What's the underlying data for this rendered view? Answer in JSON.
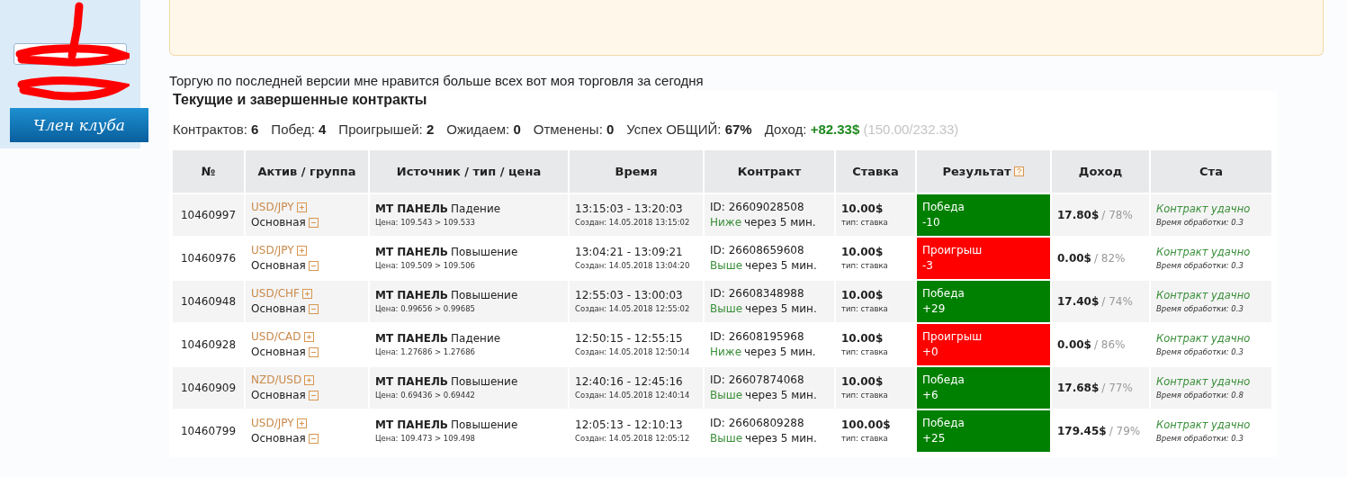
{
  "sidebar": {
    "badge": "Член клуба"
  },
  "post": {
    "text": "Торгую по последней версии мне нравится больше всех вот моя торговля за сегодня"
  },
  "contracts": {
    "title": "Текущие и завершенные контракты",
    "stats": [
      {
        "kind": "count",
        "label": "Контрактов:",
        "value": "6"
      },
      {
        "kind": "count",
        "label": "Побед:",
        "value": "4"
      },
      {
        "kind": "count",
        "label": "Проигрышей:",
        "value": "2"
      },
      {
        "kind": "count",
        "label": "Ожидаем:",
        "value": "0"
      },
      {
        "kind": "count",
        "label": "Отменены:",
        "value": "0"
      },
      {
        "kind": "count",
        "label": "Успех ОБЩИЙ:",
        "value": "67%"
      },
      {
        "kind": "income",
        "label": "Доход:",
        "value": "+82.33$",
        "note": "(150.00/232.33)"
      }
    ],
    "columns": [
      "№",
      "Актив / группа",
      "Источник / тип / цена",
      "Время",
      "Контракт",
      "Ставка",
      "Результат",
      "Доход",
      "Ста"
    ],
    "rows": [
      {
        "id": "10460997",
        "asset": "USD/JPY",
        "group": "Основная",
        "source": "МТ ПАНЕЛЬ",
        "type": "Падение",
        "price": "Цена: 109.543 > 109.533",
        "time": "13:15:03 - 13:20:03",
        "created": "Создан: 14.05.2018 13:15:02",
        "contract_id": "ID: 26609028508",
        "direction": "Ниже",
        "term": "через 5 мин.",
        "stake": "10.00$",
        "stake_type": "тип: ставка",
        "result": {
          "kind": "win",
          "label": "Победа",
          "value": "-10"
        },
        "income": "17.80$",
        "percent": "/ 78%",
        "status": "Контракт удачно",
        "processing": "Время обработки: 0.3"
      },
      {
        "id": "10460976",
        "asset": "USD/JPY",
        "group": "Основная",
        "source": "МТ ПАНЕЛЬ",
        "type": "Повышение",
        "price": "Цена: 109.509 > 109.506",
        "time": "13:04:21 - 13:09:21",
        "created": "Создан: 14.05.2018 13:04:20",
        "contract_id": "ID: 26608659608",
        "direction": "Выше",
        "term": "через 5 мин.",
        "stake": "10.00$",
        "stake_type": "тип: ставка",
        "result": {
          "kind": "loss",
          "label": "Проигрыш",
          "value": "-3"
        },
        "income": "0.00$",
        "percent": "/ 82%",
        "status": "Контракт удачно",
        "processing": "Время обработки: 0.3"
      },
      {
        "id": "10460948",
        "asset": "USD/CHF",
        "group": "Основная",
        "source": "МТ ПАНЕЛЬ",
        "type": "Повышение",
        "price": "Цена: 0.99656 > 0.99685",
        "time": "12:55:03 - 13:00:03",
        "created": "Создан: 14.05.2018 12:55:02",
        "contract_id": "ID: 26608348988",
        "direction": "Выше",
        "term": "через 5 мин.",
        "stake": "10.00$",
        "stake_type": "тип: ставка",
        "result": {
          "kind": "win",
          "label": "Победа",
          "value": "+29"
        },
        "income": "17.40$",
        "percent": "/ 74%",
        "status": "Контракт удачно",
        "processing": "Время обработки: 0.3"
      },
      {
        "id": "10460928",
        "asset": "USD/CAD",
        "group": "Основная",
        "source": "МТ ПАНЕЛЬ",
        "type": "Падение",
        "price": "Цена: 1.27686 > 1.27686",
        "time": "12:50:15 - 12:55:15",
        "created": "Создан: 14.05.2018 12:50:14",
        "contract_id": "ID: 26608195968",
        "direction": "Ниже",
        "term": "через 5 мин.",
        "stake": "10.00$",
        "stake_type": "тип: ставка",
        "result": {
          "kind": "loss",
          "label": "Проигрыш",
          "value": "+0"
        },
        "income": "0.00$",
        "percent": "/ 86%",
        "status": "Контракт удачно",
        "processing": "Время обработки: 0.3"
      },
      {
        "id": "10460909",
        "asset": "NZD/USD",
        "group": "Основная",
        "source": "МТ ПАНЕЛЬ",
        "type": "Повышение",
        "price": "Цена: 0.69436 > 0.69442",
        "time": "12:40:16 - 12:45:16",
        "created": "Создан: 14.05.2018 12:40:14",
        "contract_id": "ID: 26607874068",
        "direction": "Выше",
        "term": "через 5 мин.",
        "stake": "10.00$",
        "stake_type": "тип: ставка",
        "result": {
          "kind": "win",
          "label": "Победа",
          "value": "+6"
        },
        "income": "17.68$",
        "percent": "/ 77%",
        "status": "Контракт удачно",
        "processing": "Время обработки: 0.8"
      },
      {
        "id": "10460799",
        "asset": "USD/JPY",
        "group": "Основная",
        "source": "МТ ПАНЕЛЬ",
        "type": "Повышение",
        "price": "Цена: 109.473 > 109.498",
        "time": "12:05:13 - 12:10:13",
        "created": "Создан: 14.05.2018 12:05:12",
        "contract_id": "ID: 26606809288",
        "direction": "Выше",
        "term": "через 5 мин.",
        "stake": "100.00$",
        "stake_type": "тип: ставка",
        "result": {
          "kind": "win",
          "label": "Победа",
          "value": "+25"
        },
        "income": "179.45$",
        "percent": "/ 79%",
        "status": "Контракт удачно",
        "processing": "Время обработки: 0.3"
      }
    ]
  }
}
